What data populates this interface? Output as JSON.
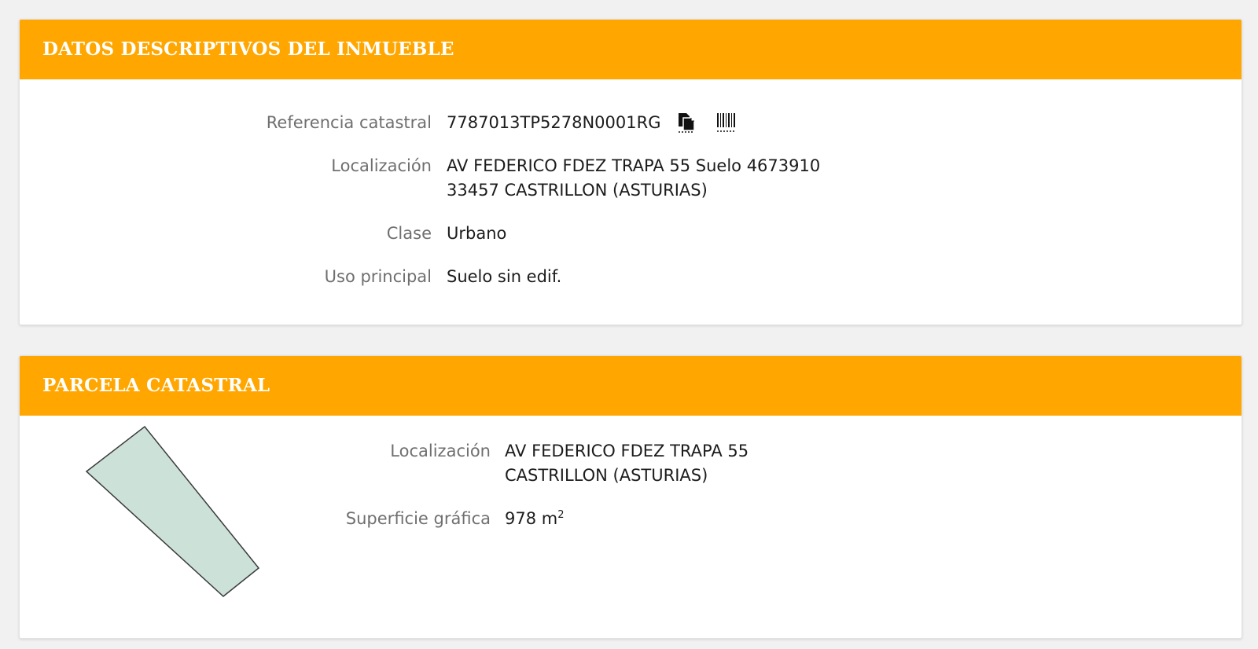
{
  "datos": {
    "title": "DATOS DESCRIPTIVOS DEL INMUEBLE",
    "rows": [
      {
        "label": "Referencia catastral",
        "value": "7787013TP5278N0001RG"
      },
      {
        "label": "Localización",
        "line1": "AV FEDERICO FDEZ TRAPA 55 Suelo 4673910",
        "line2": "33457 CASTRILLON (ASTURIAS)"
      },
      {
        "label": "Clase",
        "value": "Urbano"
      },
      {
        "label": "Uso principal",
        "value": "Suelo sin edif."
      }
    ],
    "icons": {
      "copy": "copy-document-icon",
      "barcode": "barcode-icon"
    }
  },
  "parcela": {
    "title": "PARCELA CATASTRAL",
    "rows": [
      {
        "label": "Localización",
        "line1": "AV FEDERICO FDEZ TRAPA 55",
        "line2": "CASTRILLON (ASTURIAS)"
      },
      {
        "label": "Superficie gráfica",
        "value": "978",
        "unit": "m",
        "unit_sup": "2"
      }
    ],
    "plot_fill": "#cce2d8",
    "plot_stroke": "#3a3a3a"
  },
  "colors": {
    "header": "#ffa600",
    "background": "#f1f1f1"
  }
}
